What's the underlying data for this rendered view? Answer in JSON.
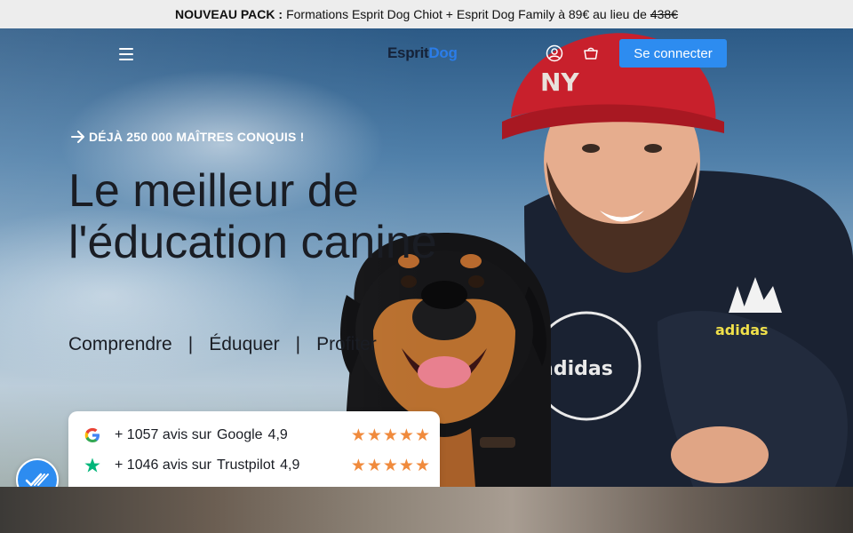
{
  "announcement": {
    "label": "NOUVEAU PACK :",
    "text": "Formations Esprit Dog Chiot + Esprit Dog Family à 89€ au lieu de",
    "old_price": "438€"
  },
  "header": {
    "logo": {
      "part1": "Esprit",
      "part2": "Dog"
    },
    "login_label": "Se connecter",
    "icons": [
      "menu-icon",
      "account-icon",
      "cart-icon"
    ]
  },
  "hero": {
    "badge": "DÉJÀ 250 000 MAÎTRES CONQUIS !",
    "headline": "Le meilleur de l'éducation canine",
    "tagline": {
      "items": [
        "Comprendre",
        "Éduquer",
        "Profiter"
      ],
      "separator": "|"
    }
  },
  "reviews": [
    {
      "icon": "google-icon",
      "count": "+ 1057 avis sur",
      "source": "Google",
      "rating": "4,9",
      "stars": "★★★★★"
    },
    {
      "icon": "trustpilot-icon",
      "count": "+ 1046 avis sur",
      "source": "Trustpilot",
      "rating": "4,9",
      "stars": "★★★★★"
    }
  ],
  "accessibility_button": {
    "icon": "accessibility-check-icon"
  },
  "colors": {
    "accent": "#2d8cf0",
    "logo_dark": "#152238",
    "logo_blue": "#2b7de9",
    "stars": "#f08a3c",
    "trustpilot": "#00b67a",
    "text": "#1a1d24"
  }
}
